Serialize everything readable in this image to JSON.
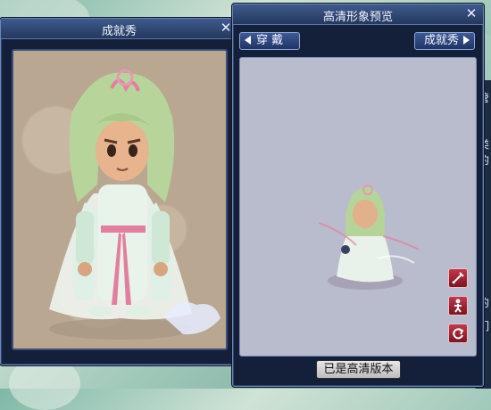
{
  "left_window": {
    "title": "成就秀",
    "close": "✕"
  },
  "right_window": {
    "title": "高清形象预览",
    "close": "✕",
    "prev_button": "穿 戴",
    "next_button": "成就秀",
    "hd_status_button": "已是高清版本"
  },
  "side_icons": [
    "sword-icon",
    "character-pose-icon",
    "rotate-icon"
  ],
  "background_strip_chars": [
    "管",
    "类",
    "的",
    "的",
    "们"
  ],
  "colors": {
    "window_bg": "#14203a",
    "title_bar": "#2f4878",
    "preview_bg": "#b8bccd",
    "portrait_bg": "#b9a792",
    "icon_red": "#a92336"
  }
}
